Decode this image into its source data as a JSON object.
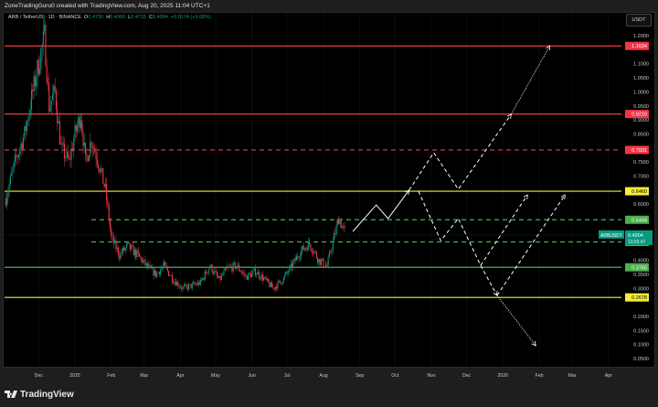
{
  "header": {
    "credit": "ZoneTradingGuru0 created with TradingView.com, Aug 20, 2025 11:04 UTC+1"
  },
  "legend": {
    "symbol": "ARB / TetherUS · 1D · BINANCE",
    "o_label": "O",
    "o": "0.4730",
    "h_label": "H",
    "h": "0.4966",
    "l_label": "L",
    "l": "0.4715",
    "c_label": "C",
    "c": "0.4904",
    "change": "+0.0174 (+3.68%)"
  },
  "currency_button": "USDT",
  "colors": {
    "up": "#089981",
    "down": "#f23645",
    "red_level": "#f23645",
    "yellow_level": "#f5eb3b",
    "green_level": "#4caf50",
    "projection": "#ffffff"
  },
  "chart_data": {
    "type": "candlestick",
    "symbol": "ARBUSDT",
    "ylim": [
      0.02,
      1.24
    ],
    "y_ticks": [
      "1.2000",
      "1.1000",
      "1.0500",
      "1.0000",
      "0.9500",
      "0.9000",
      "0.8500",
      "0.7500",
      "0.7000",
      "0.6000",
      "0.4000",
      "0.3500",
      "0.3000",
      "0.2000",
      "0.1500",
      "0.1000",
      "0.0500"
    ],
    "x_ticks": [
      "Dec",
      "2025",
      "Feb",
      "Mar",
      "Apr",
      "May",
      "Jun",
      "Jul",
      "Aug",
      "Sep",
      "Oct",
      "Nov",
      "Dec",
      "2026",
      "Feb",
      "Mar",
      "Apr"
    ],
    "x_tick_dates": [
      "2024-12-01",
      "2025-01-01",
      "2025-02-01",
      "2025-03-01",
      "2025-04-01",
      "2025-05-01",
      "2025-06-01",
      "2025-07-01",
      "2025-08-01",
      "2025-09-01",
      "2025-10-01",
      "2025-11-01",
      "2025-12-01",
      "2026-01-01",
      "2026-02-01",
      "2026-03-01",
      "2026-04-01"
    ],
    "price_path": [
      [
        "2024-11-03",
        0.62
      ],
      [
        "2024-11-11",
        0.75
      ],
      [
        "2024-11-19",
        0.85
      ],
      [
        "2024-11-26",
        1.0
      ],
      [
        "2024-12-01",
        1.1
      ],
      [
        "2024-12-06",
        1.2
      ],
      [
        "2024-12-10",
        0.95
      ],
      [
        "2024-12-15",
        1.0
      ],
      [
        "2024-12-20",
        0.8
      ],
      [
        "2024-12-27",
        0.75
      ],
      [
        "2025-01-01",
        0.85
      ],
      [
        "2025-01-06",
        0.92
      ],
      [
        "2025-01-10",
        0.75
      ],
      [
        "2025-01-15",
        0.83
      ],
      [
        "2025-01-21",
        0.75
      ],
      [
        "2025-01-27",
        0.65
      ],
      [
        "2025-02-01",
        0.48
      ],
      [
        "2025-02-08",
        0.42
      ],
      [
        "2025-02-15",
        0.45
      ],
      [
        "2025-02-23",
        0.42
      ],
      [
        "2025-03-03",
        0.38
      ],
      [
        "2025-03-11",
        0.35
      ],
      [
        "2025-03-18",
        0.38
      ],
      [
        "2025-03-26",
        0.33
      ],
      [
        "2025-04-03",
        0.3
      ],
      [
        "2025-04-11",
        0.31
      ],
      [
        "2025-04-18",
        0.32
      ],
      [
        "2025-04-26",
        0.38
      ],
      [
        "2025-05-04",
        0.33
      ],
      [
        "2025-05-11",
        0.37
      ],
      [
        "2025-05-19",
        0.38
      ],
      [
        "2025-05-27",
        0.34
      ],
      [
        "2025-06-04",
        0.36
      ],
      [
        "2025-06-12",
        0.33
      ],
      [
        "2025-06-19",
        0.3
      ],
      [
        "2025-06-27",
        0.33
      ],
      [
        "2025-07-05",
        0.38
      ],
      [
        "2025-07-12",
        0.43
      ],
      [
        "2025-07-20",
        0.46
      ],
      [
        "2025-07-28",
        0.4
      ],
      [
        "2025-08-04",
        0.38
      ],
      [
        "2025-08-11",
        0.5
      ],
      [
        "2025-08-14",
        0.55
      ],
      [
        "2025-08-20",
        0.4904
      ]
    ],
    "levels": [
      {
        "price": 1.1634,
        "label": "1.1634",
        "color": "red",
        "style": "solid"
      },
      {
        "price": 0.921,
        "label": "0.9210",
        "color": "red",
        "style": "solid"
      },
      {
        "price": 0.7931,
        "label": "0.7931",
        "color": "red",
        "style": "dashed"
      },
      {
        "price": 0.646,
        "label": "0.6460",
        "color": "yellow",
        "style": "solid"
      },
      {
        "price": 0.5444,
        "label": "0.5444",
        "color": "green",
        "style": "dashed"
      },
      {
        "price": 0.4654,
        "label": "0.4654",
        "color": "green",
        "style": "dashed"
      },
      {
        "price": 0.375,
        "label": "0.3750",
        "color": "green",
        "style": "solid"
      },
      {
        "price": 0.2678,
        "label": "0.2678",
        "color": "yellow",
        "style": "solid"
      }
    ],
    "last_price": {
      "symbol": "ARBUSDT",
      "price": "0.4904",
      "countdown": "13:55:47"
    },
    "projections": [
      {
        "style": "solid",
        "points": [
          [
            "2025-08-26",
            0.503
          ],
          [
            "2025-09-15",
            0.597
          ],
          [
            "2025-09-25",
            0.549
          ],
          [
            "2025-10-13",
            0.65
          ]
        ]
      },
      {
        "style": "dashed",
        "points": [
          [
            "2025-10-13",
            0.65
          ],
          [
            "2025-11-03",
            0.783
          ],
          [
            "2025-11-24",
            0.653
          ],
          [
            "2026-01-08",
            0.92
          ]
        ]
      },
      {
        "style": "dotted",
        "points": [
          [
            "2026-01-08",
            0.92
          ],
          [
            "2026-02-10",
            1.164
          ]
        ]
      },
      {
        "style": "dashed",
        "points": [
          [
            "2025-10-21",
            0.646
          ],
          [
            "2025-11-09",
            0.47
          ],
          [
            "2025-11-24",
            0.549
          ],
          [
            "2025-12-13",
            0.382
          ],
          [
            "2025-12-27",
            0.275
          ]
        ]
      },
      {
        "style": "dotted",
        "points": [
          [
            "2025-12-27",
            0.275
          ],
          [
            "2026-01-29",
            0.096
          ]
        ]
      },
      {
        "style": "dashed",
        "points": [
          [
            "2025-12-13",
            0.382
          ],
          [
            "2026-01-22",
            0.633
          ]
        ]
      },
      {
        "style": "dashed",
        "points": [
          [
            "2025-12-27",
            0.275
          ],
          [
            "2026-02-23",
            0.633
          ]
        ]
      }
    ]
  },
  "footer": {
    "brand": "TradingView"
  }
}
